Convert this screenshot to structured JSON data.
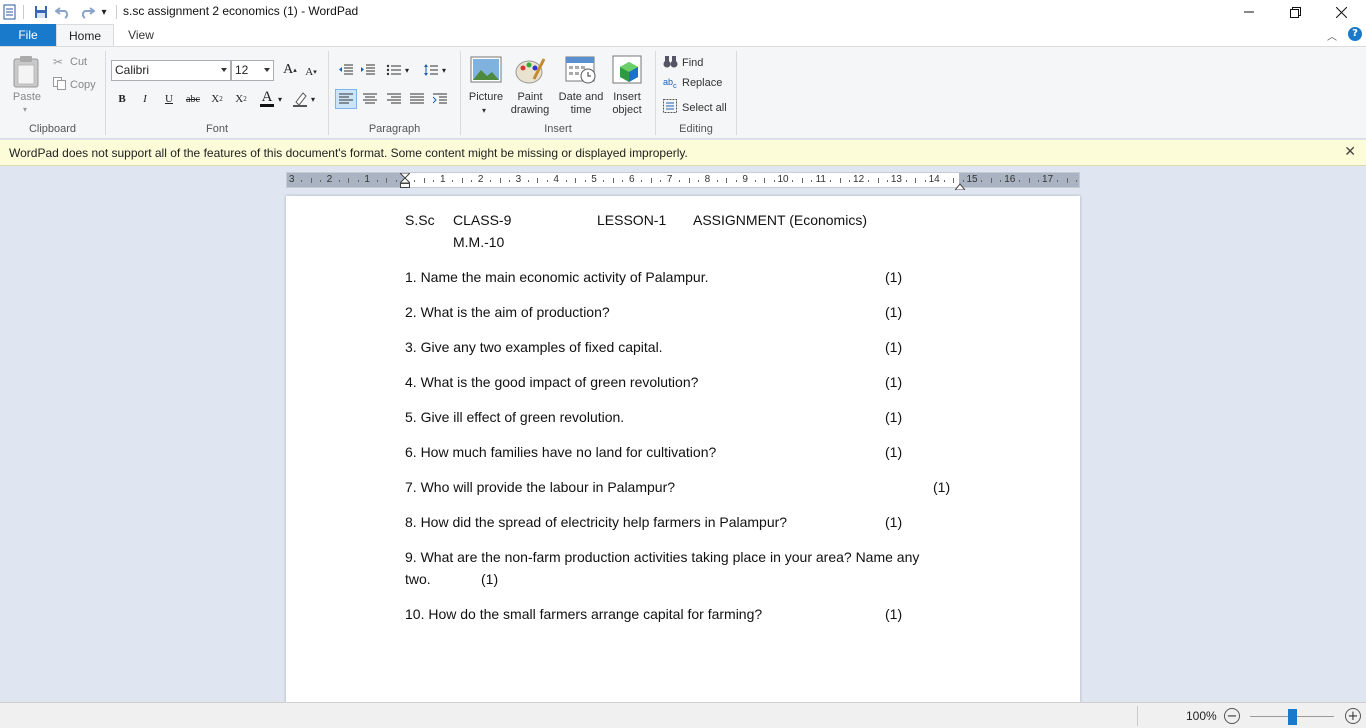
{
  "window": {
    "title": "s.sc assignment 2 economics (1) - WordPad",
    "quick_access_dropdown": "▾"
  },
  "tabs": [
    {
      "label": "File"
    },
    {
      "label": "Home"
    },
    {
      "label": "View"
    }
  ],
  "ribbon": {
    "clipboard": {
      "paste": "Paste",
      "cut": "Cut",
      "copy": "Copy",
      "group": "Clipboard"
    },
    "font": {
      "family": "Calibri",
      "size": "12",
      "group": "Font"
    },
    "paragraph": {
      "group": "Paragraph"
    },
    "insert": {
      "picture": "Picture",
      "paint_line1": "Paint",
      "paint_line2": "drawing",
      "date_line1": "Date and",
      "date_line2": "time",
      "object_line1": "Insert",
      "object_line2": "object",
      "group": "Insert"
    },
    "editing": {
      "find": "Find",
      "replace": "Replace",
      "select_all": "Select all",
      "group": "Editing"
    }
  },
  "infobar": {
    "message": "WordPad does not support all of the features of this document's format. Some content might be missing or displayed improperly."
  },
  "ruler": {
    "labels": [
      "3",
      "2",
      "1",
      "1",
      "2",
      "3",
      "4",
      "5",
      "6",
      "7",
      "8",
      "9",
      "10",
      "11",
      "12",
      "13",
      "14",
      "15",
      "16",
      "17"
    ]
  },
  "document": {
    "header": {
      "subject": "S.Sc",
      "class": "CLASS-9",
      "lesson": "LESSON-1",
      "assignment": "ASSIGNMENT  (Economics)",
      "marks": "M.M.-10"
    },
    "questions": [
      {
        "text": "1. Name the main economic activity of Palampur.",
        "marks": "(1)"
      },
      {
        "text": "2.  What is the aim of production?",
        "marks": "(1)"
      },
      {
        "text": "3. Give any two examples of fixed capital.",
        "marks": "(1)"
      },
      {
        "text": "4. What is the good impact of green revolution?",
        "marks": "(1)"
      },
      {
        "text": "5. Give ill effect of green revolution.",
        "marks": "(1)"
      },
      {
        "text": "6. How much families have no land for cultivation?",
        "marks": "(1)"
      },
      {
        "text": "7. Who will provide the labour in Palampur?",
        "marks": "(1)"
      },
      {
        "text": "8. How did the spread of electricity help farmers in Palampur?",
        "marks": "(1)"
      },
      {
        "text": "9. What are the non-farm production  activities taking place in your area? Name any",
        "continuation": "two.",
        "marks": "(1)"
      },
      {
        "text": "10. How do the small farmers arrange capital for farming?",
        "marks": "(1)"
      }
    ]
  },
  "statusbar": {
    "zoom": "100%",
    "zoom_fraction": 0.5
  },
  "colors": {
    "accent": "#1979ca",
    "infobar_bg": "#fcfcd9",
    "workspace_bg": "#dfe6f1"
  }
}
